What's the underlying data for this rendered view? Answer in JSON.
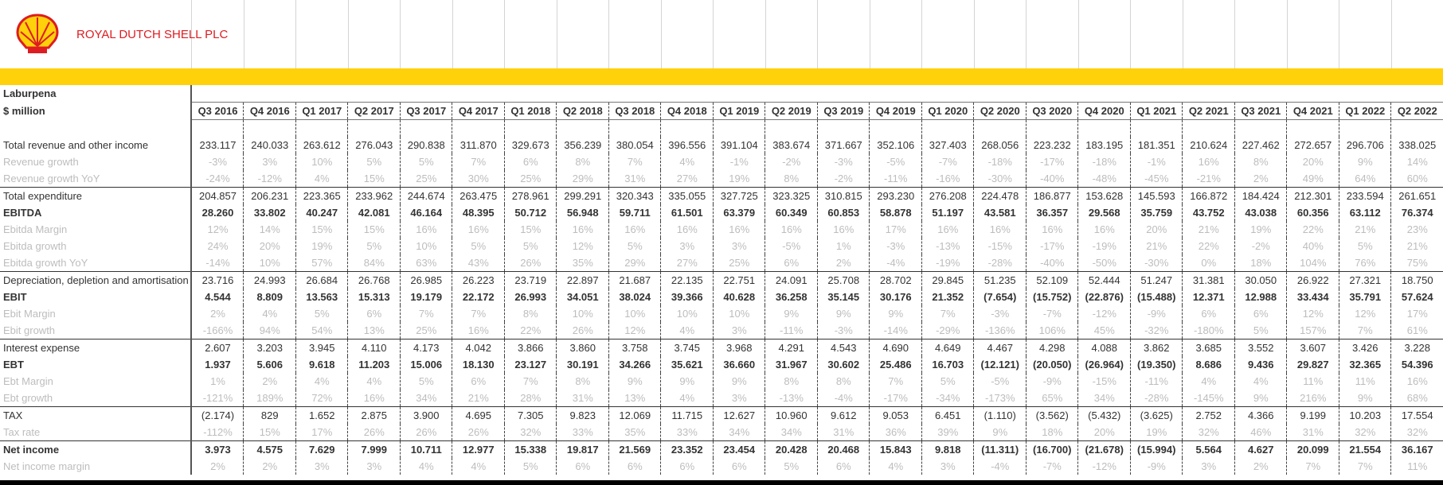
{
  "company": "ROYAL DUTCH SHELL PLC",
  "sheet_title": "Laburpena",
  "unit_label": "$ million",
  "periods": [
    "Q3 2016",
    "Q4 2016",
    "Q1 2017",
    "Q2 2017",
    "Q3 2017",
    "Q4 2017",
    "Q1 2018",
    "Q2 2018",
    "Q3 2018",
    "Q4 2018",
    "Q1 2019",
    "Q2 2019",
    "Q3 2019",
    "Q4 2019",
    "Q1 2020",
    "Q2 2020",
    "Q3 2020",
    "Q4 2020",
    "Q1 2021",
    "Q2 2021",
    "Q3 2021",
    "Q4 2021",
    "Q1 2022",
    "Q2 2022"
  ],
  "rows": [
    {
      "label": "Total revenue and other income",
      "style": "normal",
      "values": [
        "233.117",
        "240.033",
        "263.612",
        "276.043",
        "290.838",
        "311.870",
        "329.673",
        "356.239",
        "380.054",
        "396.556",
        "391.104",
        "383.674",
        "371.667",
        "352.106",
        "327.403",
        "268.056",
        "223.232",
        "183.195",
        "181.351",
        "210.624",
        "227.462",
        "272.657",
        "296.706",
        "338.025"
      ]
    },
    {
      "label": "Revenue growth",
      "style": "sub",
      "values": [
        "-3%",
        "3%",
        "10%",
        "5%",
        "5%",
        "7%",
        "6%",
        "8%",
        "7%",
        "4%",
        "-1%",
        "-2%",
        "-3%",
        "-5%",
        "-7%",
        "-18%",
        "-17%",
        "-18%",
        "-1%",
        "16%",
        "8%",
        "20%",
        "9%",
        "14%"
      ]
    },
    {
      "label": "Revenue growth YoY",
      "style": "sub",
      "values": [
        "-24%",
        "-12%",
        "4%",
        "15%",
        "25%",
        "30%",
        "25%",
        "29%",
        "31%",
        "27%",
        "19%",
        "8%",
        "-2%",
        "-11%",
        "-16%",
        "-30%",
        "-40%",
        "-48%",
        "-45%",
        "-21%",
        "2%",
        "49%",
        "64%",
        "60%"
      ]
    },
    {
      "label": "Total expenditure",
      "style": "normal",
      "values": [
        "204.857",
        "206.231",
        "223.365",
        "233.962",
        "244.674",
        "263.475",
        "278.961",
        "299.291",
        "320.343",
        "335.055",
        "327.725",
        "323.325",
        "310.815",
        "293.230",
        "276.208",
        "224.478",
        "186.877",
        "153.628",
        "145.593",
        "166.872",
        "184.424",
        "212.301",
        "233.594",
        "261.651"
      ]
    },
    {
      "label": "EBITDA",
      "style": "bold",
      "values": [
        "28.260",
        "33.802",
        "40.247",
        "42.081",
        "46.164",
        "48.395",
        "50.712",
        "56.948",
        "59.711",
        "61.501",
        "63.379",
        "60.349",
        "60.853",
        "58.878",
        "51.197",
        "43.581",
        "36.357",
        "29.568",
        "35.759",
        "43.752",
        "43.038",
        "60.356",
        "63.112",
        "76.374"
      ]
    },
    {
      "label": "Ebitda Margin",
      "style": "sub",
      "values": [
        "12%",
        "14%",
        "15%",
        "15%",
        "16%",
        "16%",
        "15%",
        "16%",
        "16%",
        "16%",
        "16%",
        "16%",
        "16%",
        "17%",
        "16%",
        "16%",
        "16%",
        "16%",
        "20%",
        "21%",
        "19%",
        "22%",
        "21%",
        "23%"
      ]
    },
    {
      "label": "Ebitda growth",
      "style": "sub",
      "values": [
        "24%",
        "20%",
        "19%",
        "5%",
        "10%",
        "5%",
        "5%",
        "12%",
        "5%",
        "3%",
        "3%",
        "-5%",
        "1%",
        "-3%",
        "-13%",
        "-15%",
        "-17%",
        "-19%",
        "21%",
        "22%",
        "-2%",
        "40%",
        "5%",
        "21%"
      ]
    },
    {
      "label": "Ebitda growth YoY",
      "style": "sub",
      "values": [
        "-14%",
        "10%",
        "57%",
        "84%",
        "63%",
        "43%",
        "26%",
        "35%",
        "29%",
        "27%",
        "25%",
        "6%",
        "2%",
        "-4%",
        "-19%",
        "-28%",
        "-40%",
        "-50%",
        "-30%",
        "0%",
        "18%",
        "104%",
        "76%",
        "75%"
      ]
    },
    {
      "label": "Depreciation, depletion and amortisation",
      "style": "normal",
      "values": [
        "23.716",
        "24.993",
        "26.684",
        "26.768",
        "26.985",
        "26.223",
        "23.719",
        "22.897",
        "21.687",
        "22.135",
        "22.751",
        "24.091",
        "25.708",
        "28.702",
        "29.845",
        "51.235",
        "52.109",
        "52.444",
        "51.247",
        "31.381",
        "30.050",
        "26.922",
        "27.321",
        "18.750"
      ]
    },
    {
      "label": "EBIT",
      "style": "bold",
      "values": [
        "4.544",
        "8.809",
        "13.563",
        "15.313",
        "19.179",
        "22.172",
        "26.993",
        "34.051",
        "38.024",
        "39.366",
        "40.628",
        "36.258",
        "35.145",
        "30.176",
        "21.352",
        "(7.654)",
        "(15.752)",
        "(22.876)",
        "(15.488)",
        "12.371",
        "12.988",
        "33.434",
        "35.791",
        "57.624"
      ]
    },
    {
      "label": "Ebit Margin",
      "style": "sub",
      "values": [
        "2%",
        "4%",
        "5%",
        "6%",
        "7%",
        "7%",
        "8%",
        "10%",
        "10%",
        "10%",
        "10%",
        "9%",
        "9%",
        "9%",
        "7%",
        "-3%",
        "-7%",
        "-12%",
        "-9%",
        "6%",
        "6%",
        "12%",
        "12%",
        "17%"
      ]
    },
    {
      "label": "Ebit growth",
      "style": "sub",
      "values": [
        "-166%",
        "94%",
        "54%",
        "13%",
        "25%",
        "16%",
        "22%",
        "26%",
        "12%",
        "4%",
        "3%",
        "-11%",
        "-3%",
        "-14%",
        "-29%",
        "-136%",
        "106%",
        "45%",
        "-32%",
        "-180%",
        "5%",
        "157%",
        "7%",
        "61%"
      ]
    },
    {
      "label": "Interest expense",
      "style": "normal",
      "values": [
        "2.607",
        "3.203",
        "3.945",
        "4.110",
        "4.173",
        "4.042",
        "3.866",
        "3.860",
        "3.758",
        "3.745",
        "3.968",
        "4.291",
        "4.543",
        "4.690",
        "4.649",
        "4.467",
        "4.298",
        "4.088",
        "3.862",
        "3.685",
        "3.552",
        "3.607",
        "3.426",
        "3.228"
      ]
    },
    {
      "label": "EBT",
      "style": "bold",
      "values": [
        "1.937",
        "5.606",
        "9.618",
        "11.203",
        "15.006",
        "18.130",
        "23.127",
        "30.191",
        "34.266",
        "35.621",
        "36.660",
        "31.967",
        "30.602",
        "25.486",
        "16.703",
        "(12.121)",
        "(20.050)",
        "(26.964)",
        "(19.350)",
        "8.686",
        "9.436",
        "29.827",
        "32.365",
        "54.396"
      ]
    },
    {
      "label": "Ebt Margin",
      "style": "sub",
      "values": [
        "1%",
        "2%",
        "4%",
        "4%",
        "5%",
        "6%",
        "7%",
        "8%",
        "9%",
        "9%",
        "9%",
        "8%",
        "8%",
        "7%",
        "5%",
        "-5%",
        "-9%",
        "-15%",
        "-11%",
        "4%",
        "4%",
        "11%",
        "11%",
        "16%"
      ]
    },
    {
      "label": "Ebt growth",
      "style": "sub",
      "values": [
        "-121%",
        "189%",
        "72%",
        "16%",
        "34%",
        "21%",
        "28%",
        "31%",
        "13%",
        "4%",
        "3%",
        "-13%",
        "-4%",
        "-17%",
        "-34%",
        "-173%",
        "65%",
        "34%",
        "-28%",
        "-145%",
        "9%",
        "216%",
        "9%",
        "68%"
      ]
    },
    {
      "label": "TAX",
      "style": "normal",
      "values": [
        "(2.174)",
        "829",
        "1.652",
        "2.875",
        "3.900",
        "4.695",
        "7.305",
        "9.823",
        "12.069",
        "11.715",
        "12.627",
        "10.960",
        "9.612",
        "9.053",
        "6.451",
        "(1.110)",
        "(3.562)",
        "(5.432)",
        "(3.625)",
        "2.752",
        "4.366",
        "9.199",
        "10.203",
        "17.554"
      ]
    },
    {
      "label": "Tax rate",
      "style": "sub",
      "values": [
        "-112%",
        "15%",
        "17%",
        "26%",
        "26%",
        "26%",
        "32%",
        "33%",
        "35%",
        "33%",
        "34%",
        "34%",
        "31%",
        "36%",
        "39%",
        "9%",
        "18%",
        "20%",
        "19%",
        "32%",
        "46%",
        "31%",
        "32%",
        "32%"
      ]
    },
    {
      "label": "Net income",
      "style": "bold",
      "values": [
        "3.973",
        "4.575",
        "7.629",
        "7.999",
        "10.711",
        "12.977",
        "15.338",
        "19.817",
        "21.569",
        "23.352",
        "23.454",
        "20.428",
        "20.468",
        "15.843",
        "9.818",
        "(11.311)",
        "(16.700)",
        "(21.678)",
        "(15.994)",
        "5.564",
        "4.627",
        "20.099",
        "21.554",
        "36.167"
      ]
    },
    {
      "label": "Net income margin",
      "style": "sub",
      "values": [
        "2%",
        "2%",
        "3%",
        "3%",
        "4%",
        "4%",
        "5%",
        "6%",
        "6%",
        "6%",
        "6%",
        "5%",
        "6%",
        "4%",
        "3%",
        "-4%",
        "-7%",
        "-12%",
        "-9%",
        "3%",
        "2%",
        "7%",
        "7%",
        "11%"
      ]
    }
  ]
}
